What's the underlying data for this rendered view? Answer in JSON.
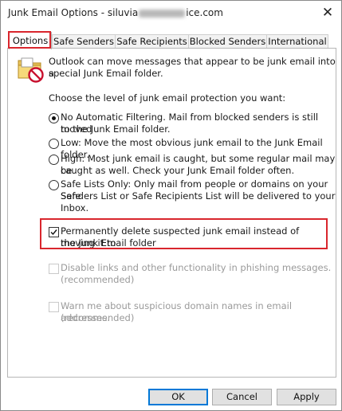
{
  "window": {
    "title_prefix": "Junk Email Options - siluvia",
    "title_suffix": "ice.com",
    "close_glyph": "✕"
  },
  "tabs": [
    {
      "label": "Options",
      "active": true
    },
    {
      "label": "Safe Senders",
      "active": false
    },
    {
      "label": "Safe Recipients",
      "active": false
    },
    {
      "label": "Blocked Senders",
      "active": false
    },
    {
      "label": "International",
      "active": false
    }
  ],
  "intro": {
    "line1": "Outlook can move messages that appear to be junk email into a",
    "line2": "special Junk Email folder."
  },
  "level_prompt": "Choose the level of junk email protection you want:",
  "options": [
    {
      "line1": "No Automatic Filtering. Mail from blocked senders is still moved",
      "line2": "to the Junk Email folder.",
      "line3": "",
      "selected": true
    },
    {
      "line1": "Low: Move the most obvious junk email to the Junk Email folder.",
      "line2": "",
      "line3": "",
      "selected": false
    },
    {
      "line1": "High: Most junk email is caught, but some regular mail may be",
      "line2": "caught as well. Check your Junk Email folder often.",
      "line3": "",
      "selected": false
    },
    {
      "line1": "Safe Lists Only: Only mail from people or domains on your Safe",
      "line2": "Senders List or Safe Recipients List will be delivered to your",
      "line3": "Inbox.",
      "selected": false
    }
  ],
  "permanently_delete": {
    "line1": "Permanently delete suspected junk email instead of moving it to",
    "line2": "the Junk Email folder",
    "checked": true
  },
  "disable_links": {
    "line1": "Disable links and other functionality in phishing messages.",
    "line2": "(recommended)",
    "checked": false,
    "enabled": false
  },
  "warn_domains": {
    "line1": "Warn me about suspicious domain names in email addresses.",
    "line2": "(recommended)",
    "checked": false,
    "enabled": false
  },
  "buttons": {
    "ok": "OK",
    "cancel": "Cancel",
    "apply": "Apply"
  },
  "colors": {
    "highlight": "#d9262d",
    "default_button_border": "#0078d7"
  },
  "icons": {
    "title_close": "close-icon",
    "junk_folder": "junk-folder-icon",
    "checkmark": "checkmark-icon"
  }
}
